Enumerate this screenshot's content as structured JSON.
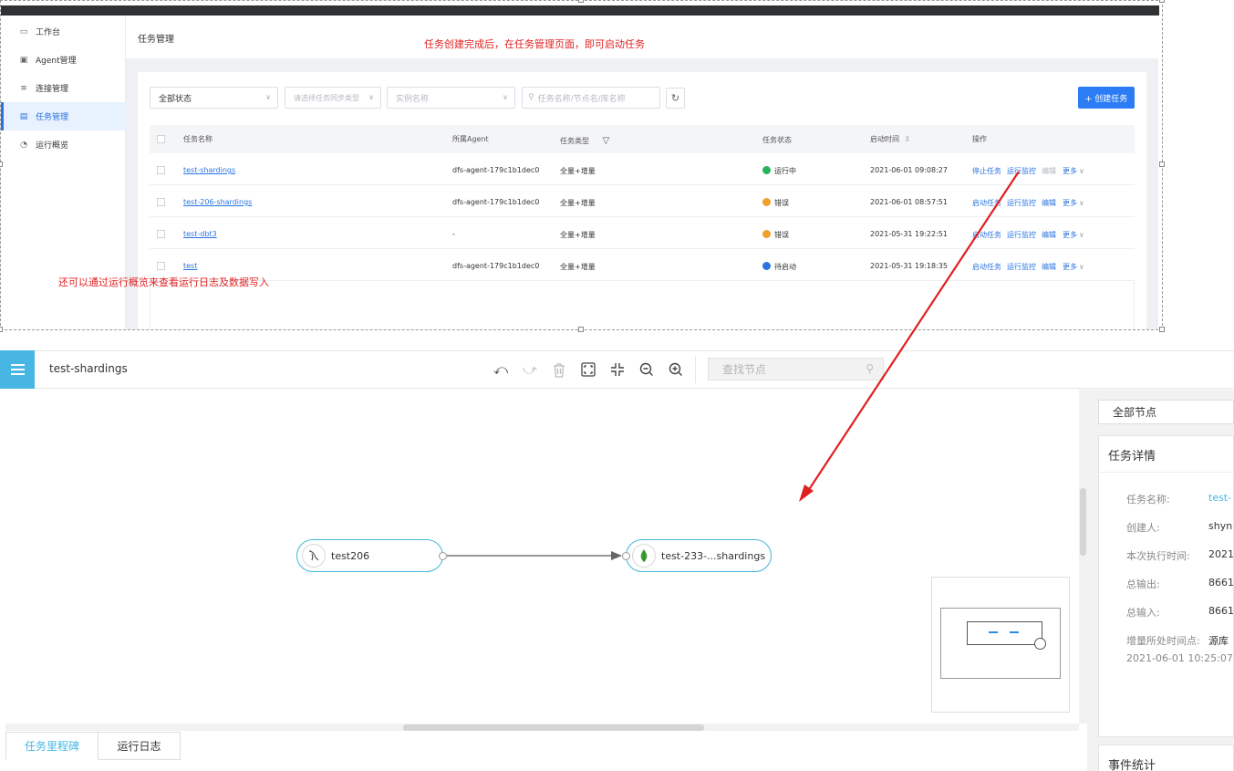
{
  "annotations": {
    "top_note": "任务创建完成后，在任务管理页面，即可启动任务",
    "left_note": "还可以通过运行概览来查看运行日志及数据写入"
  },
  "sidebar": {
    "items": [
      {
        "label": "工作台",
        "icon": "monitor-icon"
      },
      {
        "label": "Agent管理",
        "icon": "agent-icon"
      },
      {
        "label": "连接管理",
        "icon": "connection-icon"
      },
      {
        "label": "任务管理",
        "icon": "task-icon",
        "active": true
      },
      {
        "label": "运行概览",
        "icon": "pie-chart-icon"
      }
    ]
  },
  "page": {
    "breadcrumb": "任务管理",
    "filters": {
      "status": "全部状态",
      "sync_type_placeholder": "请选择任务同步类型",
      "instance_placeholder": "实例名称",
      "search_placeholder": "任务名称/节点名/库名称"
    },
    "create_button": "+ 创建任务",
    "table": {
      "headers": [
        "任务名称",
        "所属Agent",
        "任务类型",
        "任务状态",
        "启动时间",
        "操作"
      ],
      "rows": [
        {
          "name": "test-shardings",
          "agent": "dfs-agent-179c1b1dec0",
          "type": "全量+增量",
          "status": "运行中",
          "status_color": "#29b35a",
          "start": "2021-06-01 09:08:27",
          "op1": "停止任务",
          "op2": "运行监控",
          "op3": "编辑",
          "op3_disabled": true,
          "more": "更多"
        },
        {
          "name": "test-206-shardings",
          "agent": "dfs-agent-179c1b1dec0",
          "type": "全量+增量",
          "status": "错误",
          "status_color": "#f0a02a",
          "start": "2021-06-01 08:57:51",
          "op1": "启动任务",
          "op2": "运行监控",
          "op3": "编辑",
          "op3_disabled": false,
          "more": "更多"
        },
        {
          "name": "test-dbt3",
          "agent": "-",
          "type": "全量+增量",
          "status": "错误",
          "status_color": "#f0a02a",
          "start": "2021-05-31 19:22:51",
          "op1": "启动任务",
          "op2": "运行监控",
          "op3": "编辑",
          "op3_disabled": false,
          "more": "更多"
        },
        {
          "name": "test",
          "agent": "dfs-agent-179c1b1dec0",
          "type": "全量+增量",
          "status": "待启动",
          "status_color": "#2a74e0",
          "start": "2021-05-31 19:18:35",
          "op1": "启动任务",
          "op2": "运行监控",
          "op3": "编辑",
          "op3_disabled": false,
          "more": "更多"
        }
      ]
    }
  },
  "editor": {
    "title": "test-shardings",
    "search_placeholder": "查找节点",
    "nodes": [
      {
        "label": "test206",
        "icon": "mysql-icon"
      },
      {
        "label": "test-233-...shardings",
        "icon": "mongodb-icon"
      }
    ],
    "bottom_tabs": [
      "任务里程碑",
      "运行日志"
    ]
  },
  "right_panel": {
    "node_filter": "全部节点",
    "details_title": "任务详情",
    "details": [
      {
        "key": "任务名称:",
        "value": "test-"
      },
      {
        "key": "创建人:",
        "value": "shyn"
      },
      {
        "key": "本次执行时间:",
        "value": "2021"
      },
      {
        "key": "总输出:",
        "value": "8661"
      },
      {
        "key": "总输入:",
        "value": "8661"
      },
      {
        "key": "增量所处时间点:",
        "value": "源库"
      }
    ],
    "incremental_time": "2021-06-01 10:25:07",
    "events_title": "事件统计"
  },
  "colors": {
    "accent": "#2b7cf5",
    "editor_accent": "#48b6e2",
    "annotation": "#e02020"
  }
}
